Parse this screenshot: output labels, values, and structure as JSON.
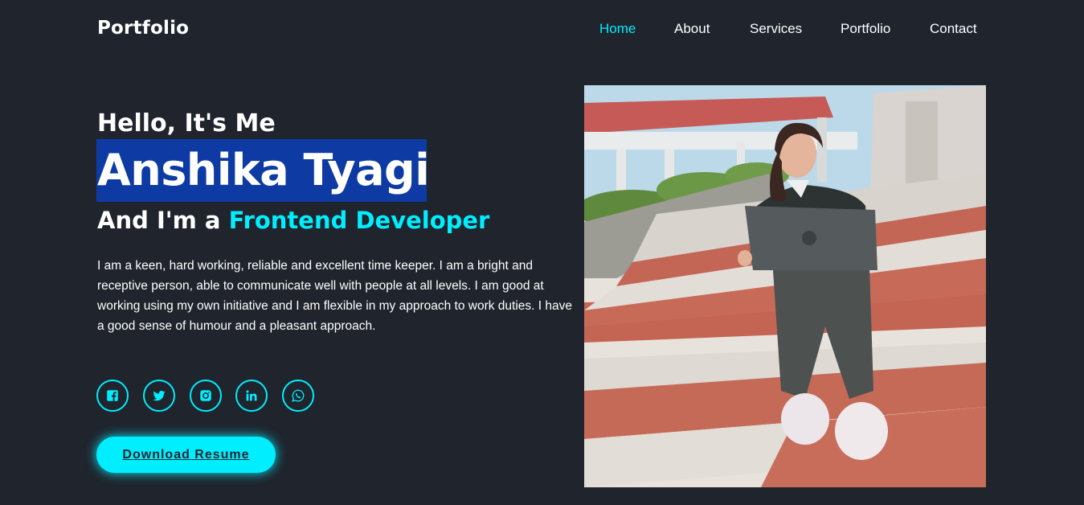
{
  "header": {
    "logo": "Portfolio",
    "nav": [
      {
        "label": "Home",
        "active": true
      },
      {
        "label": "About",
        "active": false
      },
      {
        "label": "Services",
        "active": false
      },
      {
        "label": "Portfolio",
        "active": false
      },
      {
        "label": "Contact",
        "active": false
      }
    ]
  },
  "hero": {
    "greeting": "Hello, It's Me",
    "name": "Anshika Tyagi",
    "role_prefix": "And I'm a ",
    "role_highlight": "Frontend Developer",
    "bio": "I am a keen, hard working, reliable and excellent time keeper. I am a bright and receptive person, able to communicate well with people at all levels. I am good at working using my own initiative and I am flexible in my approach to work duties. I have a good sense of humour and a pleasant approach.",
    "socials": [
      {
        "icon": "facebook-icon"
      },
      {
        "icon": "twitter-icon"
      },
      {
        "icon": "instagram-icon"
      },
      {
        "icon": "linkedin-icon"
      },
      {
        "icon": "whatsapp-icon"
      }
    ],
    "button_label": "Download Resume"
  },
  "colors": {
    "background": "#1f242d",
    "accent": "#00eeff",
    "name_highlight": "#0d3ba3",
    "text": "#ffffff"
  }
}
